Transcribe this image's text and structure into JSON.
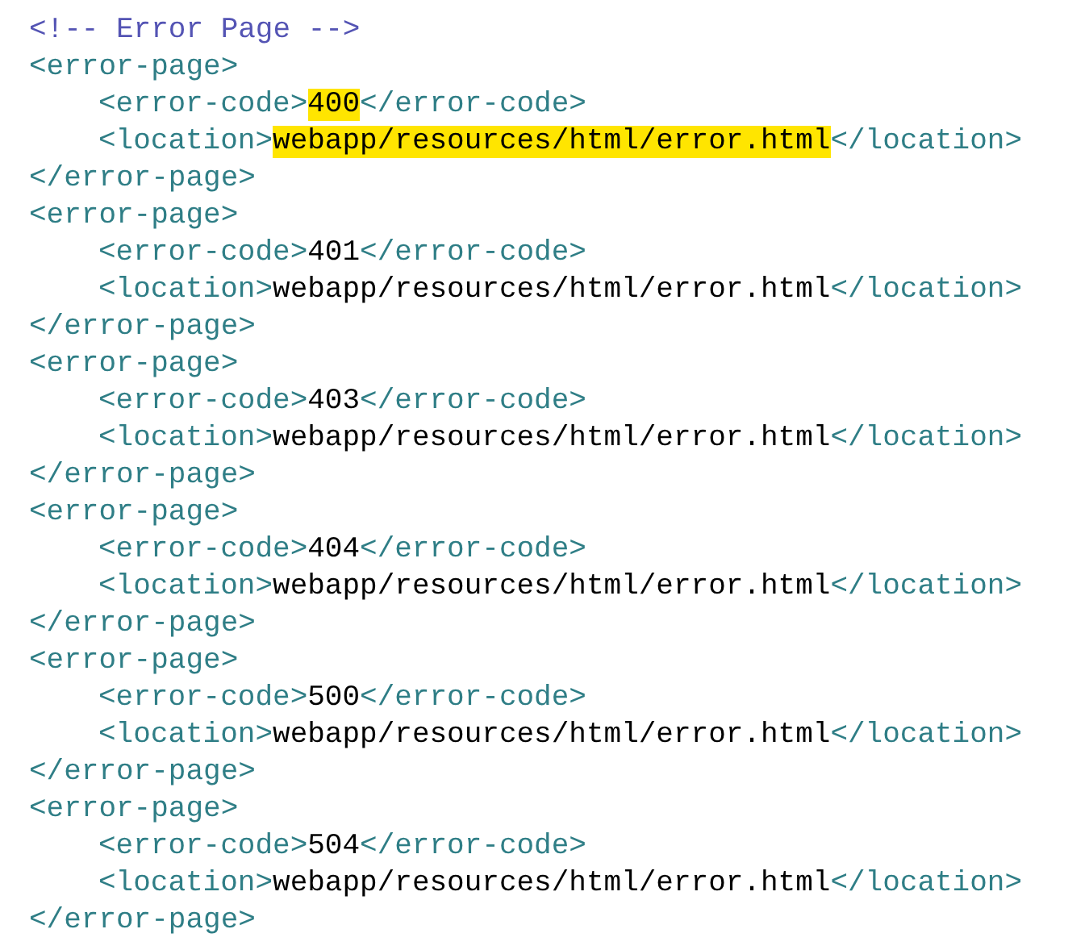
{
  "comment": "<!-- Error Page -->",
  "error_pages": [
    {
      "open_tag": "<error-page>",
      "code_open": "<error-code>",
      "code": "400",
      "code_close": "</error-code>",
      "location_open": "<location>",
      "location": "webapp/resources/html/error.html",
      "location_close": "</location>",
      "close_tag": "</error-page>",
      "highlighted": true
    },
    {
      "open_tag": "<error-page>",
      "code_open": "<error-code>",
      "code": "401",
      "code_close": "</error-code>",
      "location_open": "<location>",
      "location": "webapp/resources/html/error.html",
      "location_close": "</location>",
      "close_tag": "</error-page>",
      "highlighted": false
    },
    {
      "open_tag": "<error-page>",
      "code_open": "<error-code>",
      "code": "403",
      "code_close": "</error-code>",
      "location_open": "<location>",
      "location": "webapp/resources/html/error.html",
      "location_close": "</location>",
      "close_tag": "</error-page>",
      "highlighted": false
    },
    {
      "open_tag": "<error-page>",
      "code_open": "<error-code>",
      "code": "404",
      "code_close": "</error-code>",
      "location_open": "<location>",
      "location": "webapp/resources/html/error.html",
      "location_close": "</location>",
      "close_tag": "</error-page>",
      "highlighted": false
    },
    {
      "open_tag": "<error-page>",
      "code_open": "<error-code>",
      "code": "500",
      "code_close": "</error-code>",
      "location_open": "<location>",
      "location": "webapp/resources/html/error.html",
      "location_close": "</location>",
      "close_tag": "</error-page>",
      "highlighted": false
    },
    {
      "open_tag": "<error-page>",
      "code_open": "<error-code>",
      "code": "504",
      "code_close": "</error-code>",
      "location_open": "<location>",
      "location": "webapp/resources/html/error.html",
      "location_close": "</location>",
      "close_tag": "</error-page>",
      "highlighted": false
    }
  ]
}
